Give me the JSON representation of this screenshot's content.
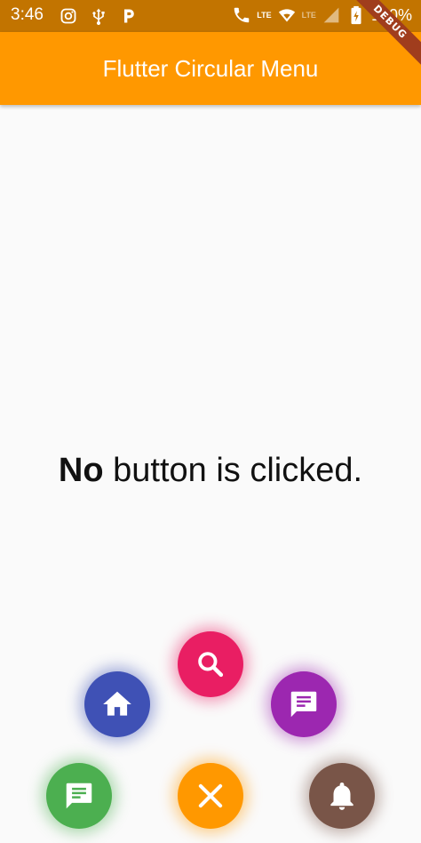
{
  "status_bar": {
    "time": "3:46",
    "battery": "100%",
    "network_label": "LTE",
    "icons_left": [
      "instagram-icon",
      "usb-icon",
      "parking-icon"
    ],
    "icons_right": [
      "volte-icon",
      "wifi-icon",
      "cell-signal-icon",
      "battery-icon"
    ]
  },
  "app_bar": {
    "title": "Flutter Circular Menu",
    "background": "#ff9800"
  },
  "debug_banner": "DEBUG",
  "message": {
    "bold": "No",
    "rest": " button is clicked."
  },
  "circular_menu": {
    "items": [
      {
        "icon": "search-icon",
        "color": "#e91e63"
      },
      {
        "icon": "home-icon",
        "color": "#3f51b5"
      },
      {
        "icon": "message-icon",
        "color": "#9c27b0"
      },
      {
        "icon": "chat-icon",
        "color": "#4caf50"
      },
      {
        "icon": "close-icon",
        "color": "#ff9800"
      },
      {
        "icon": "notifications-icon",
        "color": "#795548"
      }
    ]
  }
}
